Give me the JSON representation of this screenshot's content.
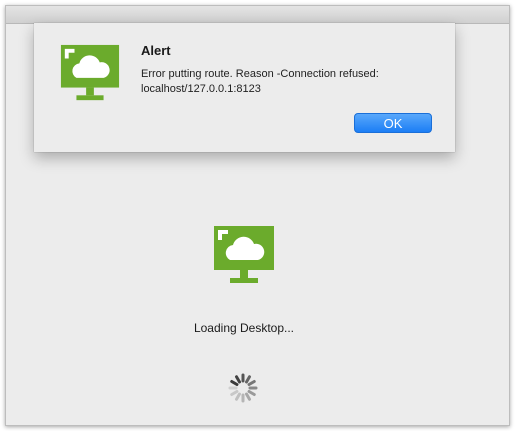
{
  "alert": {
    "title": "Alert",
    "message": "Error putting route. Reason -Connection refused: localhost/127.0.0.1:8123",
    "ok_label": "OK"
  },
  "main": {
    "loading_text": "Loading Desktop..."
  },
  "icons": {
    "app_icon": "desktop-cloud-icon",
    "spinner": "loading-spinner-icon"
  },
  "colors": {
    "brand_green": "#6bab2c",
    "button_blue": "#1c7ef5"
  }
}
